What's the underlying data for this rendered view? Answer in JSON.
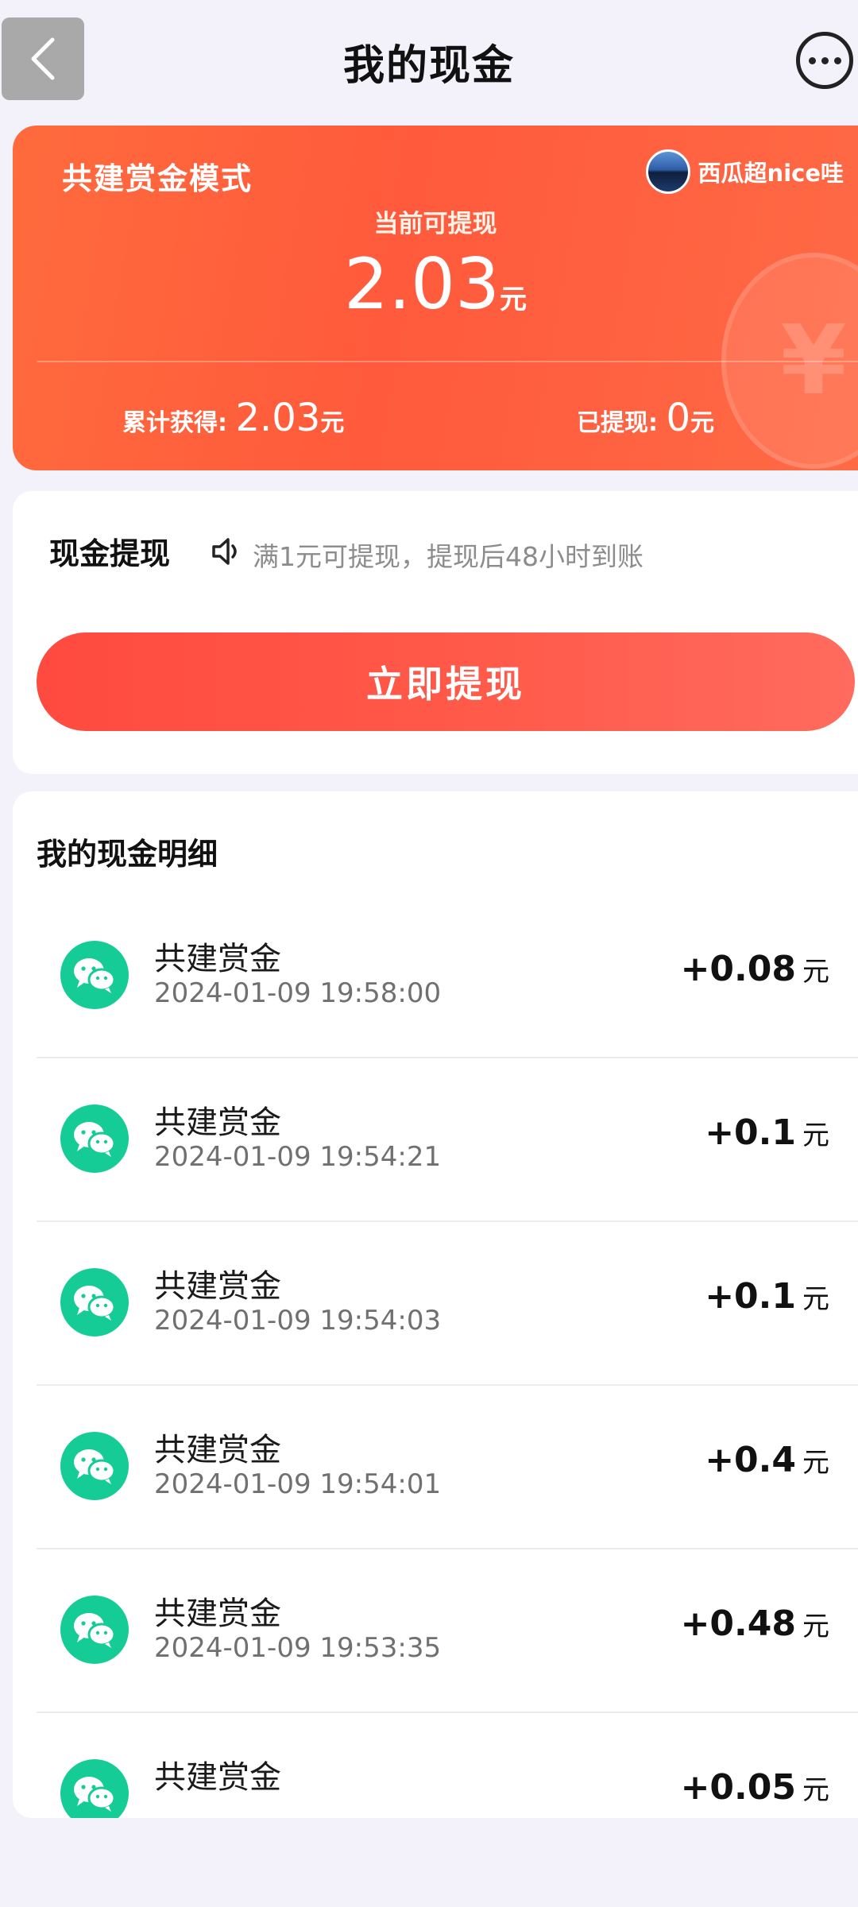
{
  "header": {
    "title": "我的现金"
  },
  "balance_card": {
    "mode_label": "共建赏金模式",
    "user_name": "西瓜超nice哇",
    "withdrawable_label": "当前可提现",
    "withdrawable_amount": "2.03",
    "unit": "元",
    "total_label": "累计获得:",
    "total_value": "2.03",
    "withdrawn_label": "已提现:",
    "withdrawn_value": "0",
    "colors": {
      "gradient_start": "#ff6b3d",
      "gradient_end": "#ff6a45"
    }
  },
  "withdraw": {
    "title": "现金提现",
    "tip": "满1元可提现，提现后48小时到账",
    "button_label": "立即提现",
    "button_color": "#ff4a3f"
  },
  "details": {
    "title": "我的现金明细",
    "icon": "wechat-icon",
    "icon_color": "#16cc96",
    "unit": "元",
    "records": [
      {
        "name": "共建赏金",
        "time": "2024-01-09 19:58:00",
        "amount": "+0.08"
      },
      {
        "name": "共建赏金",
        "time": "2024-01-09 19:54:21",
        "amount": "+0.1"
      },
      {
        "name": "共建赏金",
        "time": "2024-01-09 19:54:03",
        "amount": "+0.1"
      },
      {
        "name": "共建赏金",
        "time": "2024-01-09 19:54:01",
        "amount": "+0.4"
      },
      {
        "name": "共建赏金",
        "time": "2024-01-09 19:53:35",
        "amount": "+0.48"
      },
      {
        "name": "共建赏金",
        "time": "",
        "amount": "+0.05"
      }
    ]
  }
}
